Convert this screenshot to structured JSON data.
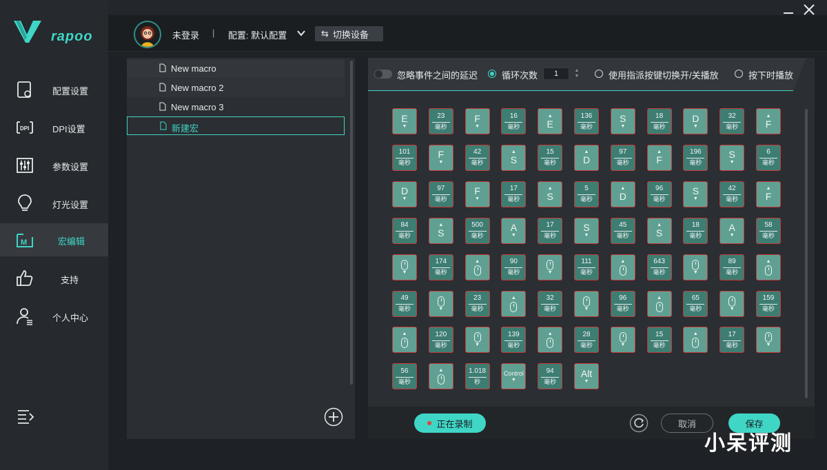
{
  "brand": {
    "name": "rapoo",
    "accent": "#3fd6c6"
  },
  "sidebar": {
    "items": [
      {
        "label": "配置设置",
        "icon": "config-icon"
      },
      {
        "label": "DPI设置",
        "icon": "dpi-icon"
      },
      {
        "label": "参数设置",
        "icon": "sliders-icon"
      },
      {
        "label": "灯光设置",
        "icon": "bulb-icon"
      },
      {
        "label": "宏编辑",
        "icon": "macro-icon",
        "active": true
      },
      {
        "label": "支持",
        "icon": "thumbs-up-icon"
      },
      {
        "label": "个人中心",
        "icon": "user-icon"
      }
    ]
  },
  "header": {
    "login": "未登录",
    "separator": "|",
    "profile": "配置: 默认配置",
    "switch_device": "切换设备"
  },
  "macros": {
    "items": [
      "New macro",
      "New macro 2",
      "New macro 3",
      "新建宏"
    ],
    "selected": "新建宏"
  },
  "options": {
    "ignore_delay": "忽略事件之间的延迟",
    "loop_count": "循环次数",
    "loop_value": "1",
    "toggle_key": "使用指派按键切换开/关播放",
    "hold_play": "按下时播放"
  },
  "events": [
    [
      "k",
      "E",
      "down"
    ],
    [
      "d",
      "23"
    ],
    [
      "k",
      "F",
      "down"
    ],
    [
      "d",
      "16"
    ],
    [
      "k",
      "E",
      "up"
    ],
    [
      "d",
      "136"
    ],
    [
      "k",
      "S",
      "down"
    ],
    [
      "d",
      "18"
    ],
    [
      "k",
      "D",
      "down"
    ],
    [
      "d",
      "32"
    ],
    [
      "k",
      "F",
      "up"
    ],
    [
      "d",
      "101"
    ],
    [
      "k",
      "F",
      "down"
    ],
    [
      "d",
      "42"
    ],
    [
      "k",
      "S",
      "up"
    ],
    [
      "d",
      "15"
    ],
    [
      "k",
      "D",
      "up"
    ],
    [
      "d",
      "97"
    ],
    [
      "k",
      "F",
      "up"
    ],
    [
      "d",
      "196"
    ],
    [
      "k",
      "S",
      "down"
    ],
    [
      "d",
      "6"
    ],
    [
      "k",
      "D",
      "down"
    ],
    [
      "d",
      "97"
    ],
    [
      "k",
      "F",
      "down"
    ],
    [
      "d",
      "17"
    ],
    [
      "k",
      "S",
      "up"
    ],
    [
      "d",
      "5"
    ],
    [
      "k",
      "D",
      "up"
    ],
    [
      "d",
      "96"
    ],
    [
      "k",
      "S",
      "down"
    ],
    [
      "d",
      "42"
    ],
    [
      "k",
      "F",
      "up"
    ],
    [
      "d",
      "84"
    ],
    [
      "k",
      "S",
      "up"
    ],
    [
      "d",
      "500"
    ],
    [
      "k",
      "A",
      "down"
    ],
    [
      "d",
      "17"
    ],
    [
      "k",
      "S",
      "down"
    ],
    [
      "d",
      "45"
    ],
    [
      "k",
      "S",
      "up"
    ],
    [
      "d",
      "18"
    ],
    [
      "k",
      "A",
      "down"
    ],
    [
      "d",
      "58"
    ],
    [
      "m",
      "down"
    ],
    [
      "d",
      "174"
    ],
    [
      "m",
      "up"
    ],
    [
      "d",
      "90"
    ],
    [
      "m",
      "down"
    ],
    [
      "d",
      "111"
    ],
    [
      "m",
      "up"
    ],
    [
      "d",
      "643"
    ],
    [
      "m",
      "down"
    ],
    [
      "d",
      "89"
    ],
    [
      "m",
      "up"
    ],
    [
      "d",
      "49"
    ],
    [
      "m",
      "down"
    ],
    [
      "d",
      "23"
    ],
    [
      "m",
      "up"
    ],
    [
      "d",
      "32"
    ],
    [
      "m",
      "down"
    ],
    [
      "d",
      "96"
    ],
    [
      "m",
      "up"
    ],
    [
      "d",
      "65"
    ],
    [
      "m",
      "down"
    ],
    [
      "d",
      "159"
    ],
    [
      "m",
      "up"
    ],
    [
      "d",
      "120"
    ],
    [
      "m",
      "down"
    ],
    [
      "d",
      "139"
    ],
    [
      "m",
      "up"
    ],
    [
      "d",
      "28"
    ],
    [
      "m",
      "down"
    ],
    [
      "d",
      "15"
    ],
    [
      "m",
      "up"
    ],
    [
      "d",
      "17"
    ],
    [
      "m",
      "down"
    ],
    [
      "d",
      "56"
    ],
    [
      "m",
      "up"
    ],
    [
      "ds",
      "1.018"
    ],
    [
      "k",
      "Control",
      "down"
    ],
    [
      "d",
      "94"
    ],
    [
      "k",
      "Alt",
      "down"
    ]
  ],
  "units": {
    "ms": "毫秒",
    "s": "秒"
  },
  "footer": {
    "recording": "正在录制",
    "cancel": "取消",
    "save": "保存"
  },
  "watermark": "小呆评测"
}
